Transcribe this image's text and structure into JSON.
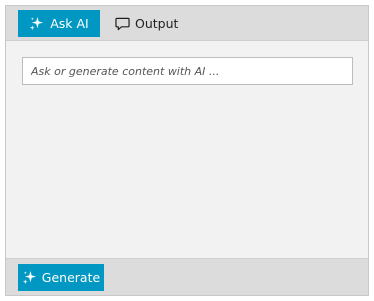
{
  "tabs": {
    "ask": {
      "label": "Ask AI",
      "icon": "sparkle-icon",
      "active": true,
      "color": "#0098c3"
    },
    "output": {
      "label": "Output",
      "icon": "comment-icon",
      "active": false
    }
  },
  "prompt": {
    "value": "",
    "placeholder": "Ask or generate content with AI ..."
  },
  "footer": {
    "generate_label": "Generate",
    "icon": "sparkle-icon",
    "color": "#0098c3"
  }
}
